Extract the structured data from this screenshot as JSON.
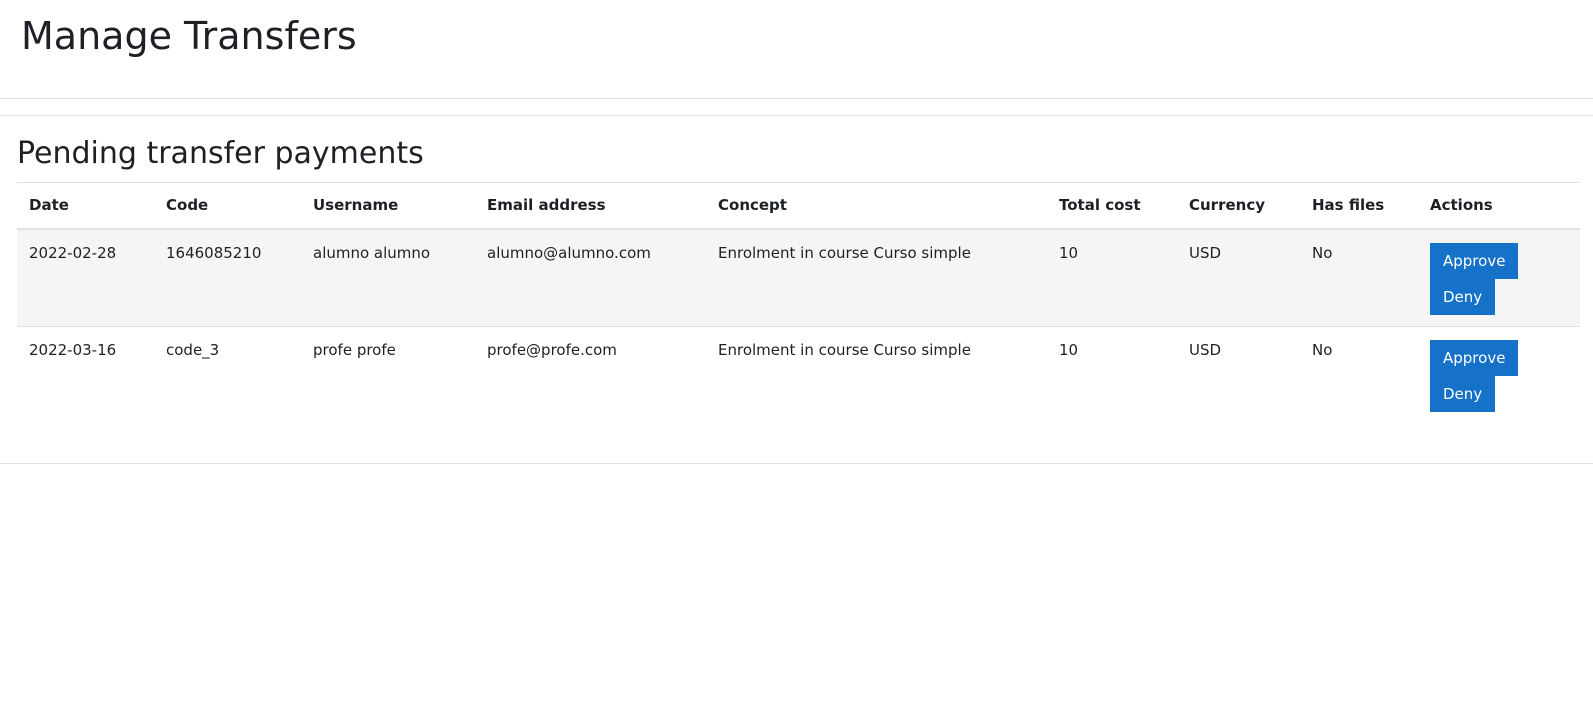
{
  "header": {
    "title": "Manage Transfers"
  },
  "section": {
    "title": "Pending transfer payments"
  },
  "table": {
    "columns": [
      "Date",
      "Code",
      "Username",
      "Email address",
      "Concept",
      "Total cost",
      "Currency",
      "Has files",
      "Actions"
    ],
    "rows": [
      {
        "date": "2022-02-28",
        "code": "1646085210",
        "username": "alumno alumno",
        "email": "alumno@alumno.com",
        "concept": "Enrolment in course Curso simple",
        "total_cost": "10",
        "currency": "USD",
        "has_files": "No",
        "approve_label": "Approve",
        "deny_label": "Deny"
      },
      {
        "date": "2022-03-16",
        "code": "code_3",
        "username": "profe profe",
        "email": "profe@profe.com",
        "concept": "Enrolment in course Curso simple",
        "total_cost": "10",
        "currency": "USD",
        "has_files": "No",
        "approve_label": "Approve",
        "deny_label": "Deny"
      }
    ]
  },
  "colors": {
    "button": "#1572c8",
    "stripe": "#f5f5f5",
    "border": "#dee2e6",
    "text": "#1d2125"
  }
}
